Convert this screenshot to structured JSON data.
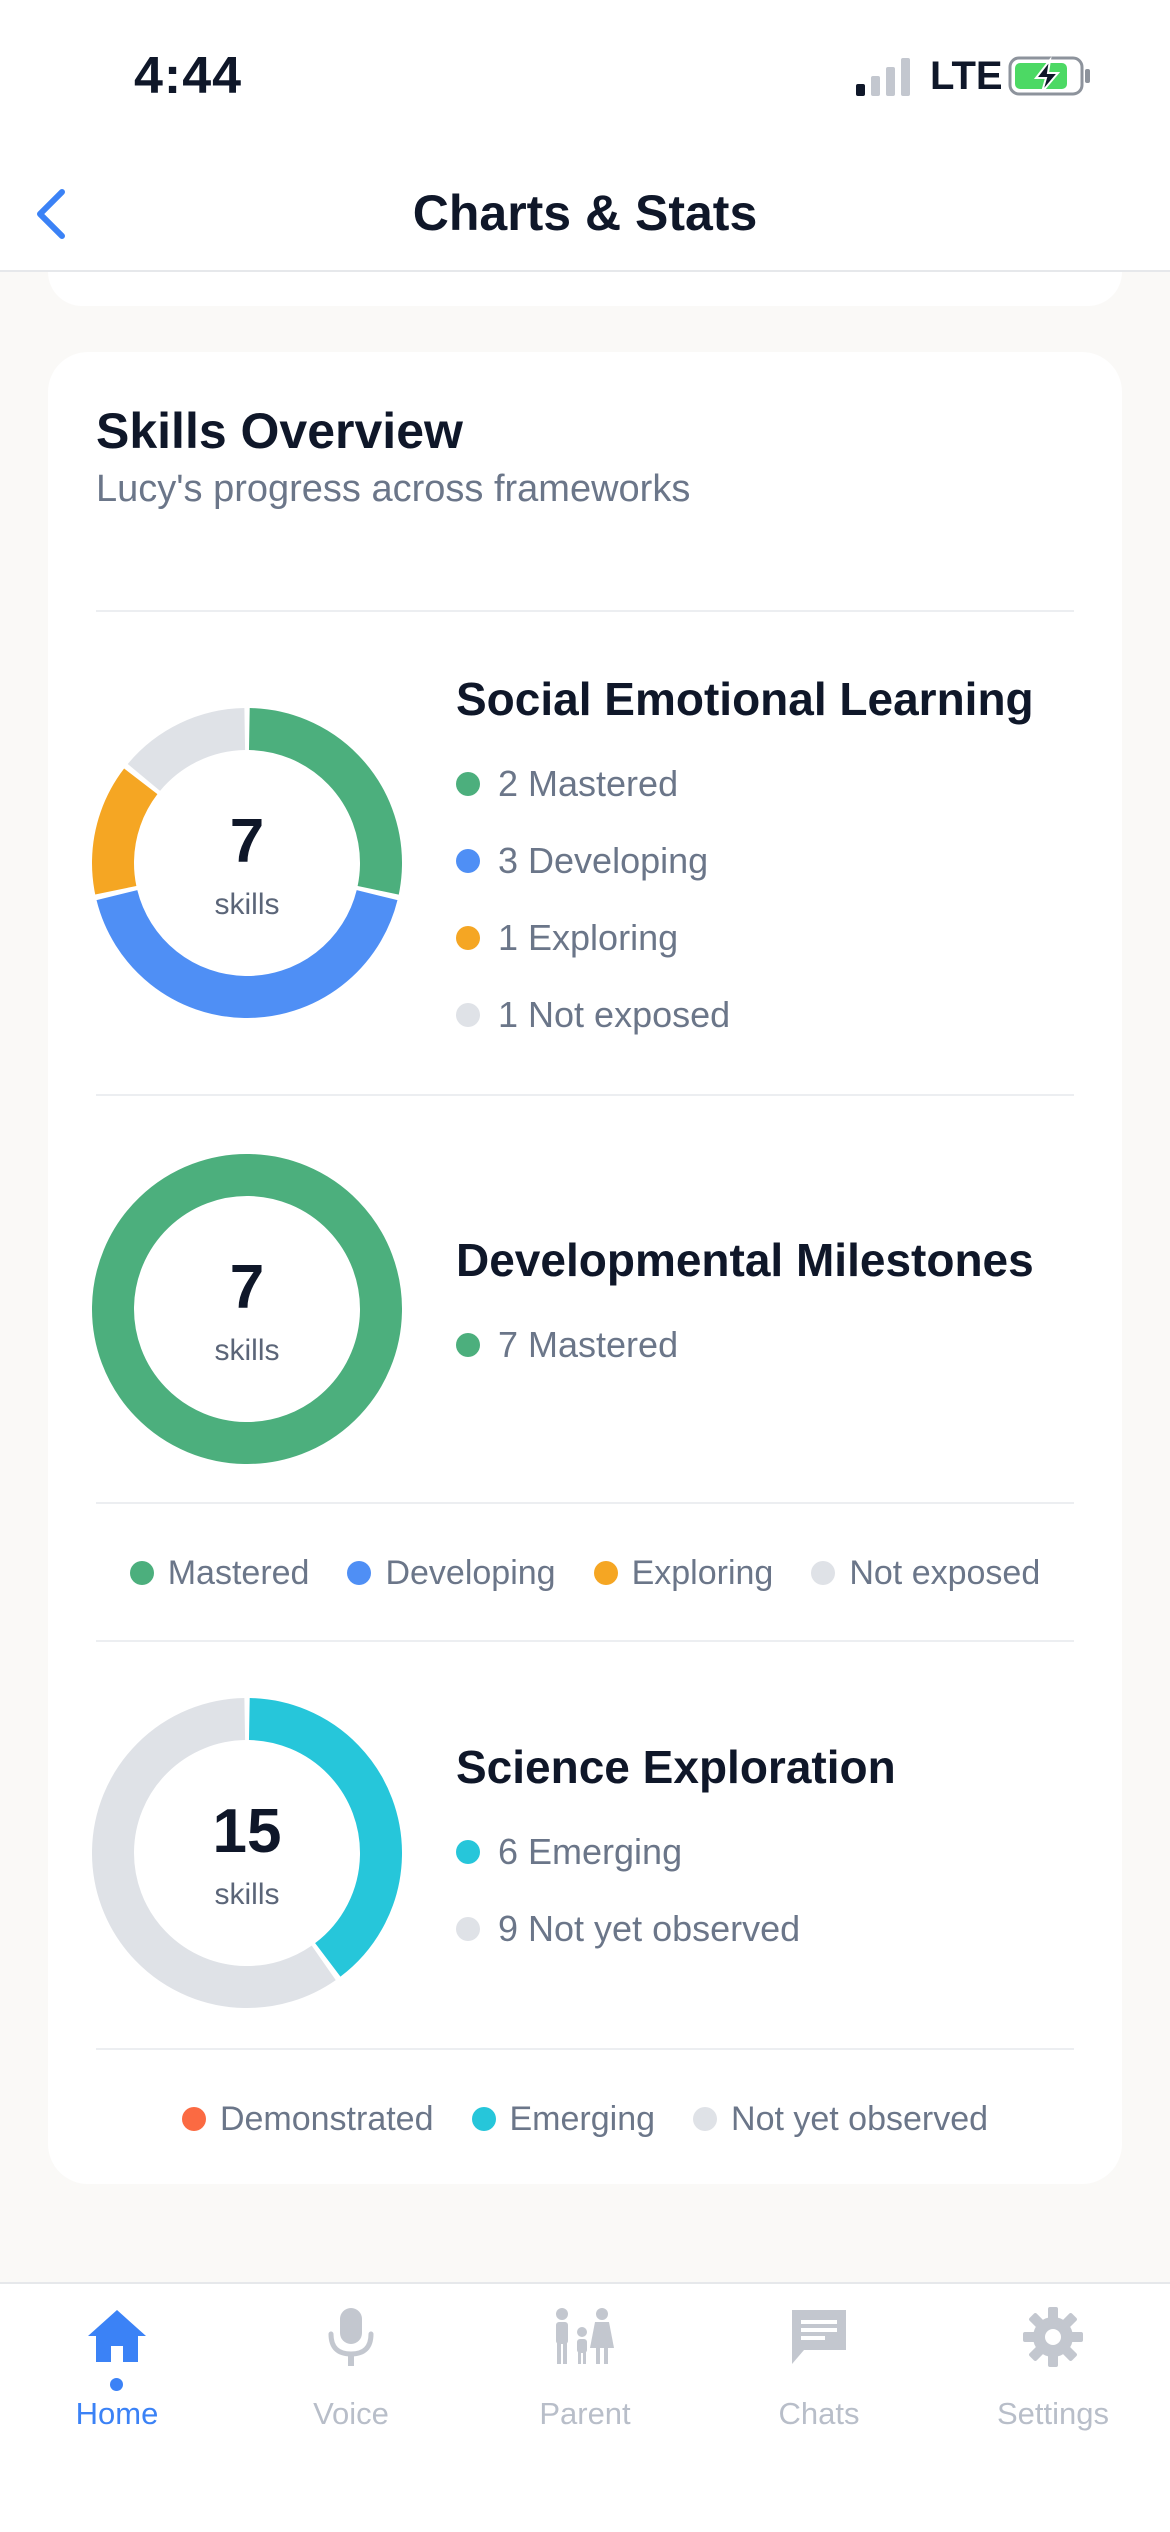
{
  "status_bar": {
    "time": "4:44",
    "carrier": "LTE"
  },
  "nav": {
    "title": "Charts & Stats",
    "back_icon": "chevron-left-icon"
  },
  "colors": {
    "mastered": "#4caf7d",
    "developing": "#4f8ff5",
    "exploring": "#f5a623",
    "not_exposed": "#dfe2e7",
    "demonstrated": "#fb6a42",
    "emerging": "#26c6da",
    "not_yet_observed": "#dfe2e7",
    "accent": "#3b82f6"
  },
  "skills_overview": {
    "title": "Skills Overview",
    "subtitle": "Lucy's progress across frameworks",
    "frameworks": [
      {
        "title": "Social Emotional Learning",
        "count": "7",
        "unit": "skills",
        "segments": [
          {
            "label": "2 Mastered",
            "value": 2,
            "color_key": "mastered"
          },
          {
            "label": "3 Developing",
            "value": 3,
            "color_key": "developing"
          },
          {
            "label": "1 Exploring",
            "value": 1,
            "color_key": "exploring"
          },
          {
            "label": "1 Not exposed",
            "value": 1,
            "color_key": "not_exposed"
          }
        ]
      },
      {
        "title": "Developmental Milestones",
        "count": "7",
        "unit": "skills",
        "segments": [
          {
            "label": "7 Mastered",
            "value": 7,
            "color_key": "mastered"
          }
        ]
      },
      {
        "title": "Science Exploration",
        "count": "15",
        "unit": "skills",
        "segments": [
          {
            "label": "6 Emerging",
            "value": 6,
            "color_key": "emerging"
          },
          {
            "label": "9 Not yet observed",
            "value": 9,
            "color_key": "not_yet_observed"
          }
        ]
      }
    ],
    "legend_1": [
      {
        "label": "Mastered",
        "color_key": "mastered"
      },
      {
        "label": "Developing",
        "color_key": "developing"
      },
      {
        "label": "Exploring",
        "color_key": "exploring"
      },
      {
        "label": "Not exposed",
        "color_key": "not_exposed"
      }
    ],
    "legend_2": [
      {
        "label": "Demonstrated",
        "color_key": "demonstrated"
      },
      {
        "label": "Emerging",
        "color_key": "emerging"
      },
      {
        "label": "Not yet observed",
        "color_key": "not_yet_observed"
      }
    ]
  },
  "tabs": [
    {
      "label": "Home",
      "icon": "home-icon",
      "active": true
    },
    {
      "label": "Voice",
      "icon": "microphone-icon",
      "active": false
    },
    {
      "label": "Parent",
      "icon": "family-icon",
      "active": false
    },
    {
      "label": "Chats",
      "icon": "chat-icon",
      "active": false
    },
    {
      "label": "Settings",
      "icon": "gear-icon",
      "active": false
    }
  ]
}
